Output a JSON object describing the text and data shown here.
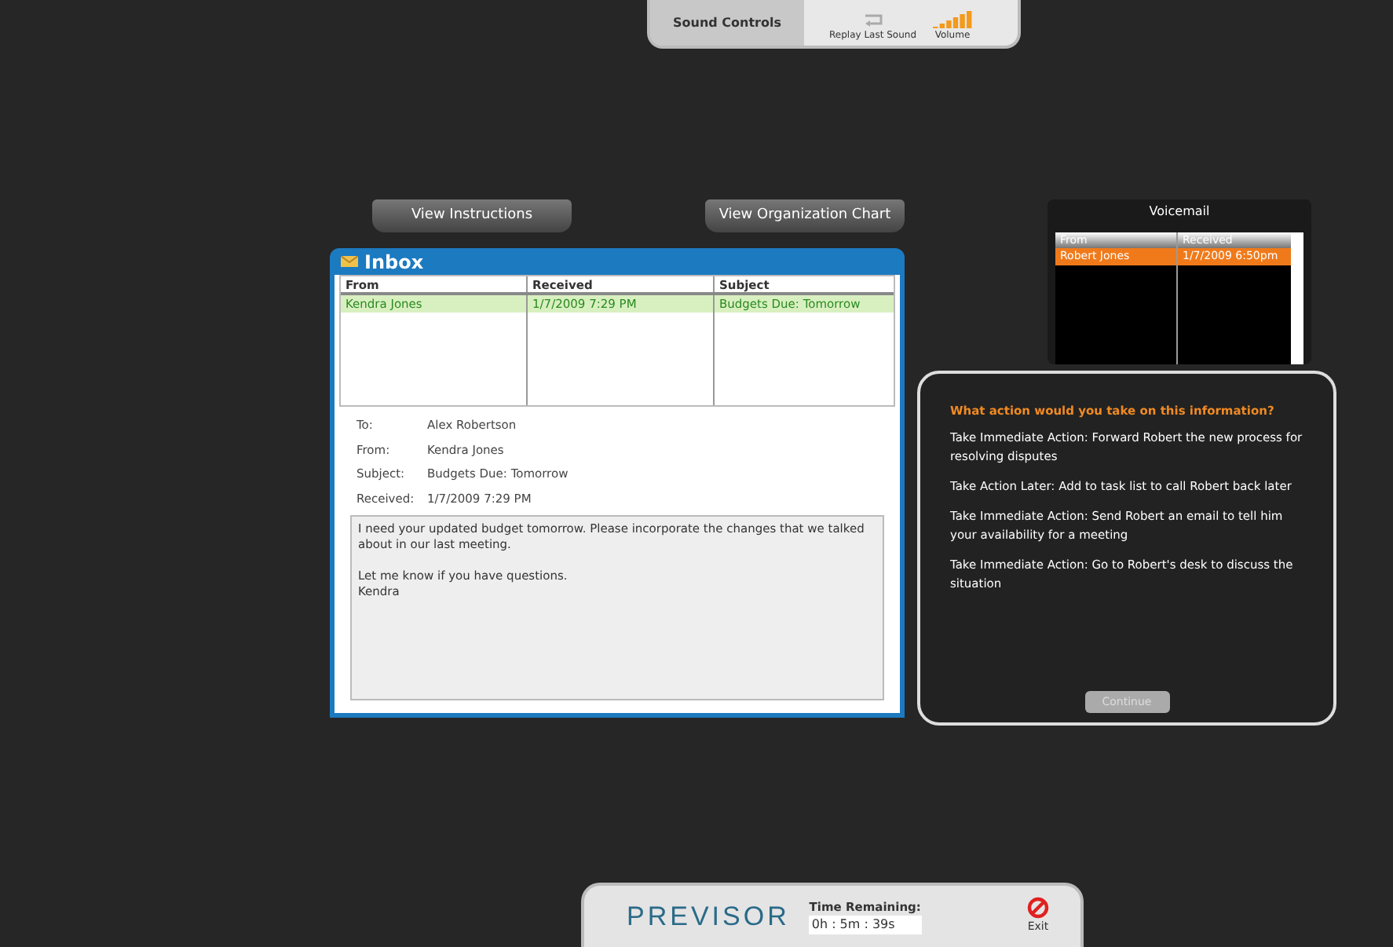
{
  "sound_controls": {
    "title": "Sound Controls",
    "replay": "Replay Last Sound",
    "volume": "Volume"
  },
  "buttons": [
    "View Instructions",
    "View Organization Chart"
  ],
  "inbox": {
    "title": "Inbox",
    "columns": [
      "From",
      "Received",
      "Subject"
    ],
    "rows": [
      {
        "from": "Kendra Jones",
        "received": "1/7/2009 7:29 PM",
        "subject": "Budgets Due: Tomorrow",
        "selected": true
      }
    ],
    "message": {
      "fields": [
        {
          "label": "To:",
          "value": "Alex Robertson"
        },
        {
          "label": "From:",
          "value": "Kendra Jones"
        },
        {
          "label": "Subject:",
          "value": "Budgets Due: Tomorrow"
        },
        {
          "label": "Received:",
          "value": "1/7/2009 7:29 PM"
        }
      ],
      "body": [
        "I need your updated budget tomorrow. Please incorporate the changes that we talked about in our last meeting.",
        "Let me know if you have questions.\nKendra"
      ]
    }
  },
  "voicemail": {
    "title": "Voicemail",
    "columns": [
      "From",
      "Received"
    ],
    "rows": [
      {
        "from": "Robert Jones",
        "received": "1/7/2009 6:50pm",
        "selected": true
      }
    ]
  },
  "question": {
    "prompt": "What action would you take on this information?",
    "options": [
      "Take Immediate Action: Forward Robert the new process for resolving disputes",
      "Take Action Later: Add to task list to call Robert back later",
      "Take Immediate Action: Send Robert an email to tell him your availability for a meeting",
      "Take Immediate Action: Go to Robert's desk to discuss the situation"
    ],
    "continue": {
      "label": "Continue",
      "disabled": true
    }
  },
  "footer": {
    "logo": "PREVISOR",
    "time_label": "Time Remaining:",
    "time_value": "0h : 5m : 39s",
    "exit": "Exit"
  }
}
